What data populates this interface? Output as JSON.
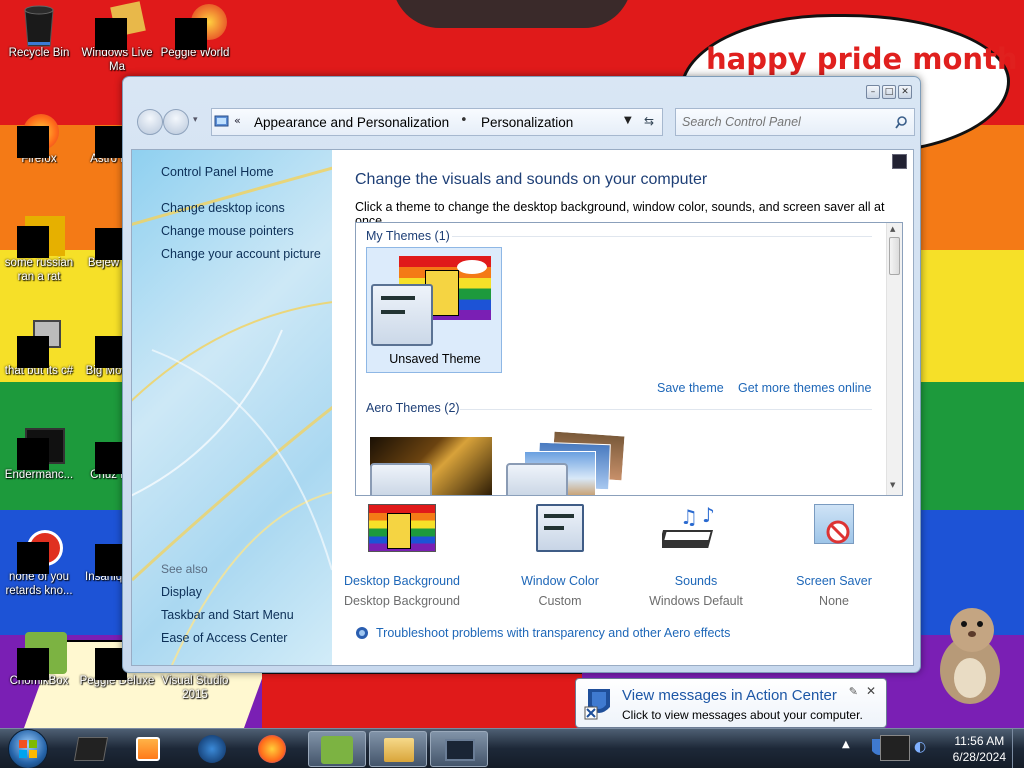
{
  "desktop": {
    "speech_text": "happy pride month",
    "icons": [
      {
        "label": "Recycle Bin"
      },
      {
        "label": "Windows Live Ma"
      },
      {
        "label": "Peggle World"
      },
      {
        "label": "Firefox"
      },
      {
        "label": "Astro Delu"
      },
      {
        "label": "some russian ran a rat"
      },
      {
        "label": "Bejew Delu"
      },
      {
        "label": "that but its c#"
      },
      {
        "label": "Big Mo Delu"
      },
      {
        "label": "Endermanc..."
      },
      {
        "label": "Chuz Delu"
      },
      {
        "label": "none of you retards kno..."
      },
      {
        "label": "Insaniq Delu"
      },
      {
        "label": "ChomikBox"
      },
      {
        "label": "Peggle Deluxe"
      },
      {
        "label": "Visual Studio 2015"
      }
    ],
    "stripe_colors": [
      "#e01a1a",
      "#f47a16",
      "#f6e028",
      "#1d9a3c",
      "#1d53d6",
      "#7a1fb4"
    ]
  },
  "window": {
    "breadcrumb": [
      "Appearance and Personalization",
      "Personalization"
    ],
    "search_placeholder": "Search Control Panel",
    "left_links": [
      "Control Panel Home",
      "Change desktop icons",
      "Change mouse pointers",
      "Change your account picture"
    ],
    "see_also_title": "See also",
    "see_also_links": [
      "Display",
      "Taskbar and Start Menu",
      "Ease of Access Center"
    ],
    "title": "Change the visuals and sounds on your computer",
    "description": "Click a theme to change the desktop background, window color, sounds, and screen saver all at once.",
    "my_themes_head": "My Themes (1)",
    "unsaved_theme": "Unsaved Theme",
    "save_theme": "Save theme",
    "get_more": "Get more themes online",
    "aero_head": "Aero Themes (2)",
    "bottom": [
      {
        "title": "Desktop Background",
        "sub": "Desktop Background"
      },
      {
        "title": "Window Color",
        "sub": "Custom"
      },
      {
        "title": "Sounds",
        "sub": "Windows Default"
      },
      {
        "title": "Screen Saver",
        "sub": "None"
      }
    ],
    "troubleshoot": "Troubleshoot problems with transparency and other Aero effects"
  },
  "notification": {
    "title": "View messages in Action Center",
    "subtitle": "Click to view messages about your computer."
  },
  "taskbar": {
    "time": "11:56 AM",
    "date": "6/28/2024"
  }
}
